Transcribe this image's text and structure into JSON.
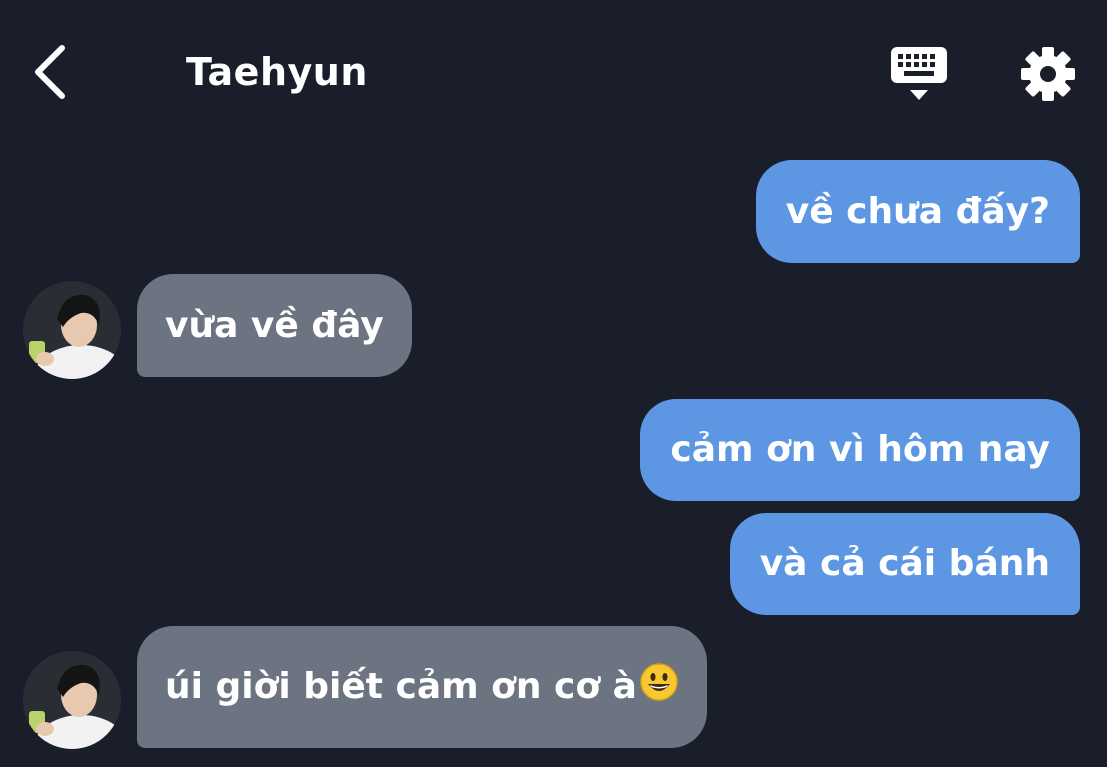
{
  "header": {
    "title": "Taehyun",
    "back_icon": "chevron-left-icon",
    "keyboard_icon": "keyboard-icon",
    "settings_icon": "gear-icon"
  },
  "messages": [
    {
      "side": "out",
      "text": "về chưa đấy?"
    },
    {
      "side": "in",
      "text": "vừa về đây"
    },
    {
      "side": "out",
      "text": "cảm ơn vì hôm nay"
    },
    {
      "side": "out",
      "text": "và cả cái bánh"
    },
    {
      "side": "in",
      "text": "úi giời biết cảm ơn cơ à",
      "emoji": "smiling-face-icon"
    }
  ],
  "colors": {
    "background": "#1a1e2b",
    "outgoing_bubble": "#5d97e3",
    "incoming_bubble": "#6c7381",
    "text": "#ffffff"
  }
}
